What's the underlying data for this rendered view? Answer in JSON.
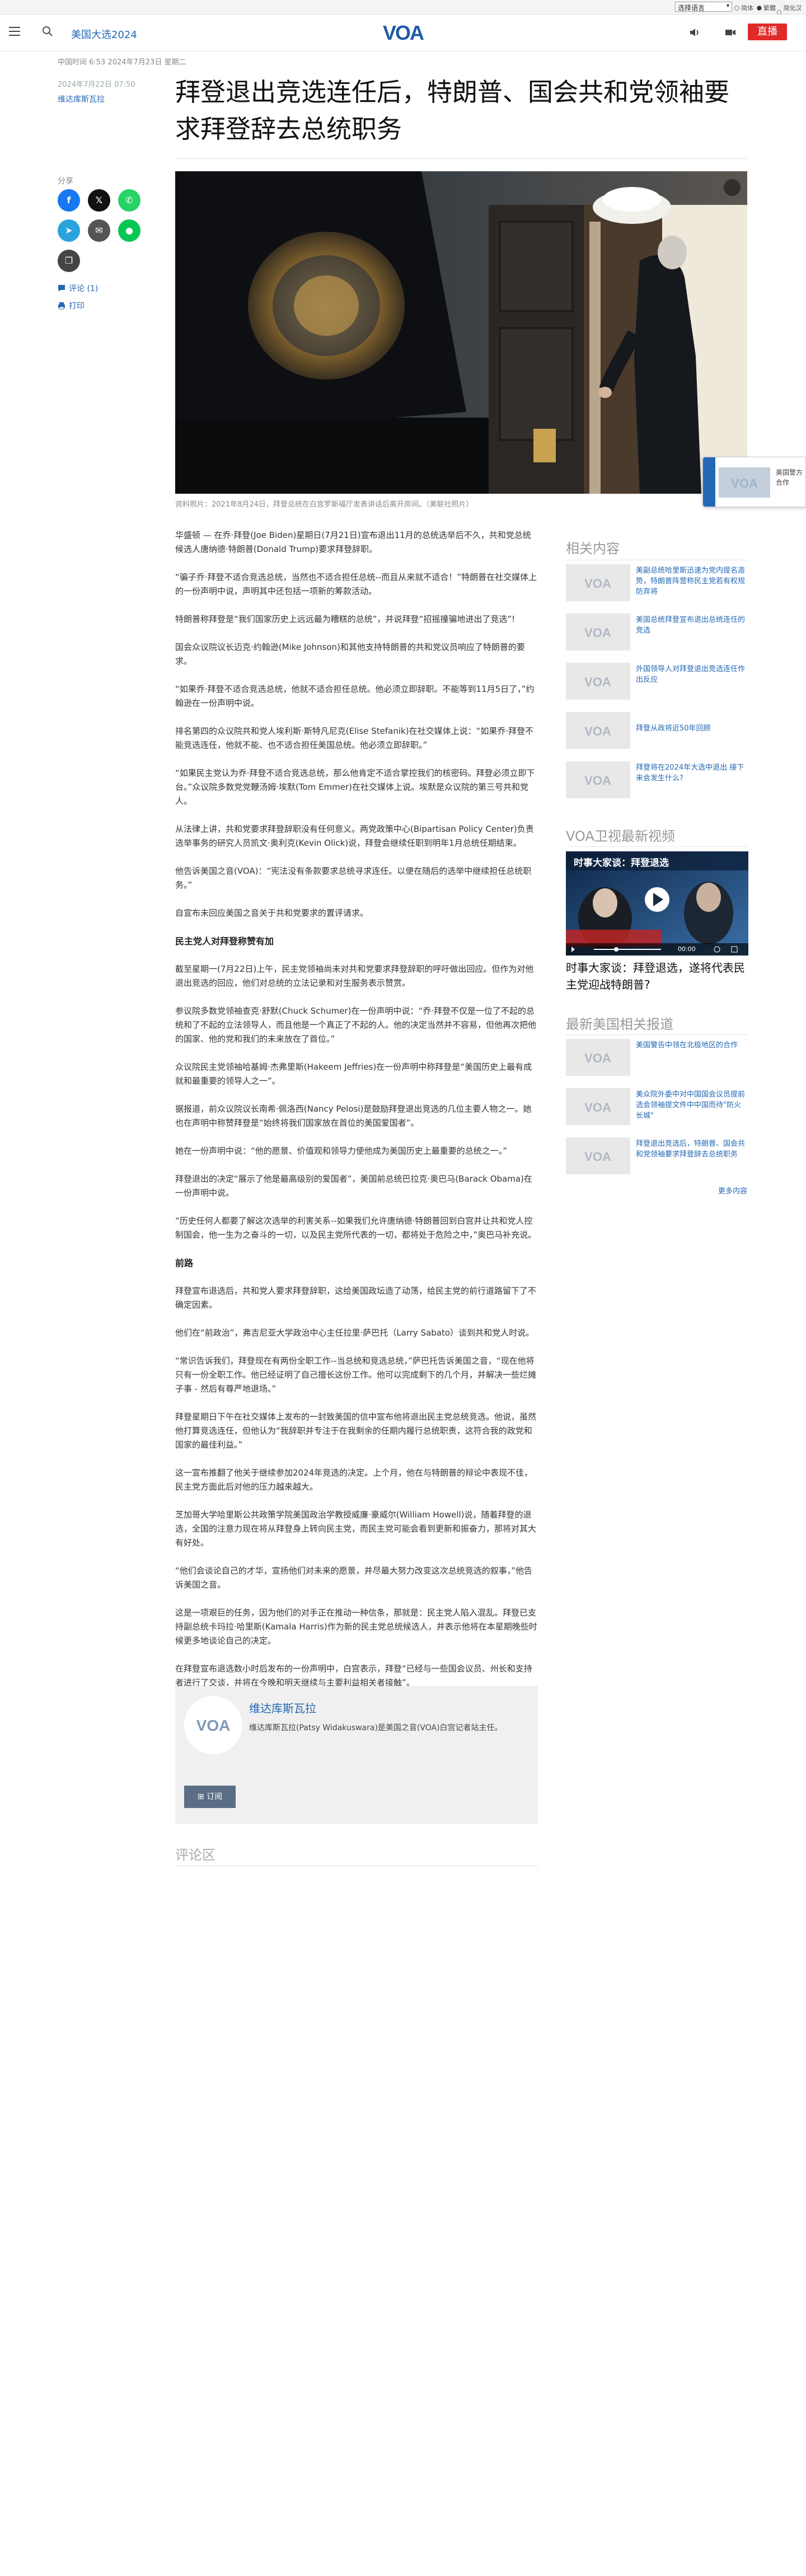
{
  "utility_bar": {
    "language_select": "选择语言",
    "lang_options": [
      {
        "label": "简体",
        "selected": false
      },
      {
        "label": "繁體",
        "selected": true
      },
      {
        "label": "简化汉字",
        "selected": false
      }
    ]
  },
  "header": {
    "section": "美国大选2024",
    "logo": "VOA",
    "live_label": "直播",
    "icons": [
      "menu-icon",
      "search-icon",
      "audio-icon",
      "video-icon"
    ]
  },
  "article": {
    "meta": "中国时间 6:53 2024年7月23日 星期二",
    "published": "2024年7月22日 07:50",
    "author": "维达库斯瓦拉",
    "title": "拜登退出竞选连任后，特朗普、国会共和党领袖要求拜登辞去总统职务",
    "share_label": "分享",
    "comments_link": "评论 (1)",
    "print_link": "打印",
    "caption": "资料照片：2021年8月24日，拜登总统在白宫罗斯福厅发表讲话后离开房间。（美联社照片）",
    "paragraphs": [
      {
        "type": "p",
        "text": "华盛顿 — 在乔·拜登(Joe Biden)星期日(7月21日)宣布退出11月的总统选举后不久，共和党总统候选人唐纳德·特朗普(Donald Trump)要求拜登辞职。"
      },
      {
        "type": "p",
        "text": "“骗子乔·拜登不适合竞选总统，当然也不适合担任总统--而且从来就不适合！”特朗普在社交媒体上的一份声明中说，声明其中还包括一项新的筹款活动。"
      },
      {
        "type": "p",
        "text": "特朗普称拜登是“我们国家历史上远远最为糟糕的总统”，并说拜登“招摇撞骗地进出了竞选”!"
      },
      {
        "type": "p",
        "text": "国会众议院议长迈克·约翰逊(Mike Johnson)和其他支持特朗普的共和党议员响应了特朗普的要求。"
      },
      {
        "type": "p",
        "text": "“如果乔·拜登不适合竞选总统，他就不适合担任总统。他必须立即辞职。不能等到11月5日了，”约翰逊在一份声明中说。"
      },
      {
        "type": "p",
        "text": "排名第四的众议院共和党人埃利斯·斯特凡尼克(Elise Stefanik)在社交媒体上说：“如果乔·拜登不能竞选连任，他就不能、也不适合担任美国总统。他必须立即辞职。”"
      },
      {
        "type": "p",
        "text": "“如果民主党认为乔·拜登不适合竞选总统，那么他肯定不适合掌控我们的核密码。拜登必须立即下台。”众议院多数党党鞭汤姆·埃默(Tom Emmer)在社交媒体上说。埃默是众议院的第三号共和党人。"
      },
      {
        "type": "p",
        "text": "从法律上讲，共和党要求拜登辞职没有任何意义。两党政策中心(Bipartisan Policy Center)负责选举事务的研究人员凯文·奥利克(Kevin Olick)说，拜登会继续任职到明年1月总统任期结束。"
      },
      {
        "type": "p",
        "text": "他告诉美国之音(VOA)：“宪法没有条款要求总统寻求连任。以便在随后的选举中继续担任总统职务。”"
      },
      {
        "type": "p",
        "text": "自宣布未回应美国之音关于共和党要求的置评请求。"
      },
      {
        "type": "h3",
        "text": "民主党人对拜登称赞有加"
      },
      {
        "type": "p",
        "text": "截至星期一(7月22日)上午，民主党领袖尚未对共和党要求拜登辞职的呼吁做出回应。但作为对他退出竞选的回应，他们对总统的立法记录和对生服务表示赞赏。"
      },
      {
        "type": "p",
        "text": "参议院多数党领袖查克·舒默(Chuck Schumer)在一份声明中说：“乔·拜登不仅是一位了不起的总统和了不起的立法领导人，而且他是一个真正了不起的人。他的决定当然并不容易，但他再次把他的国家、他的党和我们的未来放在了首位。”"
      },
      {
        "type": "p",
        "text": "众议院民主党领袖哈基姆·杰弗里斯(Hakeem Jeffries)在一份声明中称拜登是“美国历史上最有成就和最重要的领导人之一”。"
      },
      {
        "type": "p",
        "text": "据报道，前众议院议长南希·佩洛西(Nancy Pelosi)是鼓励拜登退出竞选的几位主要人物之一。她也在声明中称赞拜登是“始终将我们国家放在首位的美国爱国者”。"
      },
      {
        "type": "p",
        "text": "她在一份声明中说：“他的愿景、价值观和领导力使他成为美国历史上最重要的总统之一。”"
      },
      {
        "type": "p",
        "text": "拜登退出的决定“展示了他是最高级别的爱国者”，美国前总统巴拉克·奥巴马(Barack Obama)在一份声明中说。"
      },
      {
        "type": "p",
        "text": "“历史任何人都要了解这次选举的利害关系--如果我们允许唐纳德·特朗普回到白宫并让共和党人控制国会，他一生为之奋斗的一切，以及民主党所代表的一切，都将处于危险之中，”奥巴马补充说。"
      },
      {
        "type": "h3",
        "text": "前路"
      },
      {
        "type": "p",
        "text": "拜登宣布退选后，共和党人要求拜登辞职，这给美国政坛造了动荡，给民主党的前行道路留下了不确定因素。"
      },
      {
        "type": "p",
        "text": "他们在“前政治”，弗吉尼亚大学政治中心主任拉里·萨巴托（Larry Sabato）谈到共和党人时说。"
      },
      {
        "type": "p",
        "text": "“常识告诉我们，拜登现在有两份全职工作--当总统和竞选总统，”萨巴托告诉美国之音，“现在他将只有一份全职工作。他已经证明了自己擅长这份工作。他可以完成剩下的几个月，并解决一些烂摊子事 - 然后有尊严地退场。”"
      },
      {
        "type": "p",
        "text": "拜登星期日下午在社交媒体上发布的一封致美国的信中宣布他将退出民主党总统竞选。他说，虽然他打算竞选连任，但他认为“我辞职并专注于在我剩余的任期内履行总统职责，这符合我的政党和国家的最佳利益。”"
      },
      {
        "type": "p",
        "text": "这一宣布推翻了他关于继续参加2024年竞选的决定。上个月，他在与特朗普的辩论中表现不佳，民主党方面此后对他的压力越来越大。"
      },
      {
        "type": "p",
        "text": "芝加哥大学哈里斯公共政策学院美国政治学教授威廉·豪威尔(William Howell)说，随着拜登的退选，全国的注意力现在将从拜登身上转向民主党，而民主党可能会看到更新和振奋力，那将对其大有好处。"
      },
      {
        "type": "p",
        "text": "“他们会谈论自己的才华，宣扬他们对未来的愿景，并尽最大努力改变这次总统竞选的叙事，”他告诉美国之音。"
      },
      {
        "type": "p",
        "text": "这是一项艰巨的任务，因为他们的对手正在推动一种信条，那就是：民主党人陷入混乱。拜登已支持副总统卡玛拉·哈里斯(Kamala Harris)作为新的民主党总统候选人，并表示他将在本星期晚些时候更多地谈论自己的决定。"
      },
      {
        "type": "p",
        "text": "在拜登宣布退选数小时后发布的一份声明中，白宫表示，拜登“已经与一些国会议员、州长和支持者进行了交谈，并将在今晚和明天继续与主要利益相关者接触”。"
      }
    ]
  },
  "author_box": {
    "name": "维达库斯瓦拉",
    "bio": "维达库斯瓦拉(Patsy Widakuswara)是美国之音(VOA)白宫记者站主任。",
    "subscribe": "订阅"
  },
  "comments": {
    "heading": "评论区"
  },
  "sidebar": {
    "related_heading": "相关内容",
    "related": [
      "美副总统哈里斯迅速为党内提名造势，特朗普阵营称民主党若有权规防弃将",
      "美国总统拜登宣布退出总统连任的竞选",
      "外国领导人对拜登退出竞选连任作出反应",
      "拜登从政将近50年回顾",
      "拜登将在2024年大选中退出 接下来会发生什么?"
    ],
    "video_heading": "VOA卫视最新视频",
    "video": {
      "overlay_title": "时事大家谈：拜登退选",
      "title": "时事大家谈：拜登退选，遂将代表民主党迎战特朗普?",
      "time": "00:00"
    },
    "latest_heading": "最新美国相关报道",
    "latest": [
      "美国警告中领在北极地区的合作",
      "美众院外委中对中国国会议员提前选会领袖提文件中中国而待\"防火长城\"",
      "拜登退出竞选后，特朗普、国会共和党领袖要求拜登辞去总统职务"
    ],
    "more": "更多内容"
  },
  "floating_promo": {
    "text": "美国警方合作"
  },
  "colors": {
    "accent": "#2368b5",
    "live": "#e02a2a",
    "facebook": "#1877f2",
    "x": "#111111",
    "whatsapp": "#25d366",
    "telegram": "#2aa3dc",
    "email": "#555555",
    "line": "#06c755",
    "copy": "#444444"
  }
}
